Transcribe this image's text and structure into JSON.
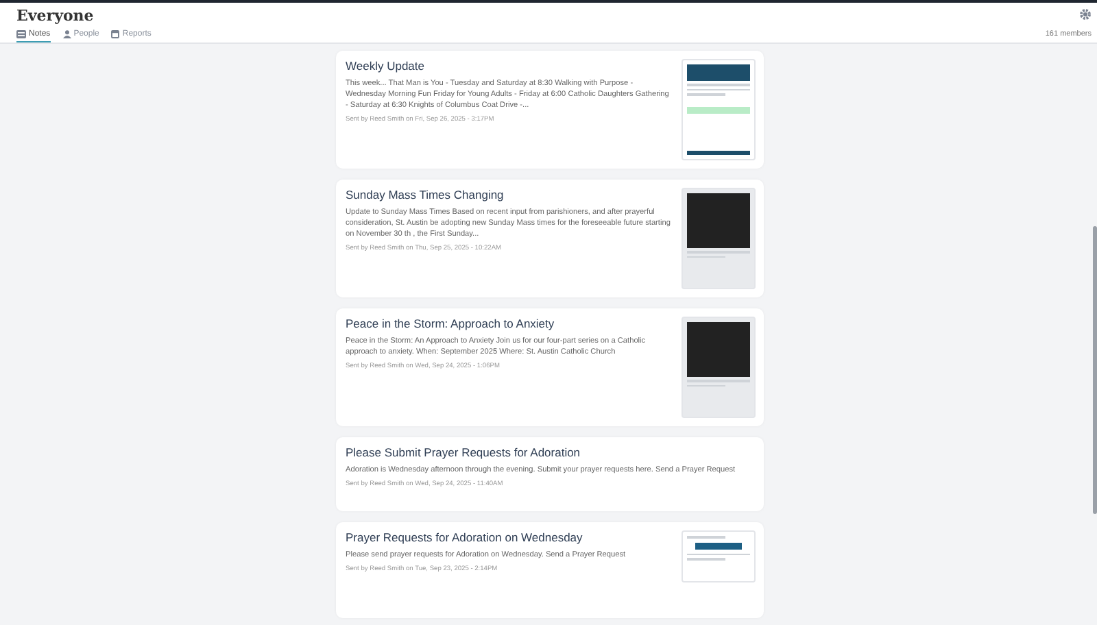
{
  "header": {
    "title": "Everyone",
    "members": "161 members"
  },
  "tabs": [
    {
      "label": "Notes",
      "kind": "notes",
      "selected": true
    },
    {
      "label": "People",
      "kind": "people",
      "selected": false
    },
    {
      "label": "Reports",
      "kind": "reports",
      "selected": false
    }
  ],
  "notes": [
    {
      "title": "Weekly Update",
      "body": "This week... That Man is You - Tuesday and Saturday at 8:30 Walking with Purpose - Wednesday Morning Fun Friday for Young Adults - Friday at 6:00 Catholic Daughters Gathering - Saturday at 6:30 Knights of Columbus Coat Drive -...",
      "sent": "Sent by Reed Smith on Fri, Sep 26, 2025 - 3:17PM",
      "kind": "newsletter"
    },
    {
      "title": "Sunday Mass Times Changing",
      "body": "Update to Sunday Mass Times Based on recent input from parishioners, and after prayerful consideration, St. Austin be adopting new Sunday Mass times for the foreseeable future   starting   on November 30 th , the First Sunday...",
      "sent": "Sent by Reed Smith on Thu, Sep 25, 2025 - 10:22AM",
      "kind": "flyer"
    },
    {
      "title": "Peace in the Storm: Approach to Anxiety",
      "body": "Peace in the Storm:  An Approach to Anxiety Join us for our four-part series on a Catholic approach to anxiety.  When: September 2025 Where: St. Austin Catholic Church",
      "sent": "Sent by Reed Smith on Wed, Sep 24, 2025 - 1:06PM",
      "kind": "flyer"
    },
    {
      "title": "Please Submit Prayer Requests for Adoration",
      "body": "Adoration is Wednesday afternoon through the evening. Submit your prayer requests here. Send a Prayer Request",
      "sent": "Sent by Reed Smith on Wed, Sep 24, 2025 - 11:40AM",
      "kind": "plain"
    },
    {
      "title": "Prayer Requests for Adoration on Wednesday",
      "body": "Please send prayer requests for Adoration on Wednesday. Send a Prayer Request",
      "sent": "Sent by Reed Smith on Tue, Sep 23, 2025 - 2:14PM",
      "kind": "form"
    }
  ]
}
